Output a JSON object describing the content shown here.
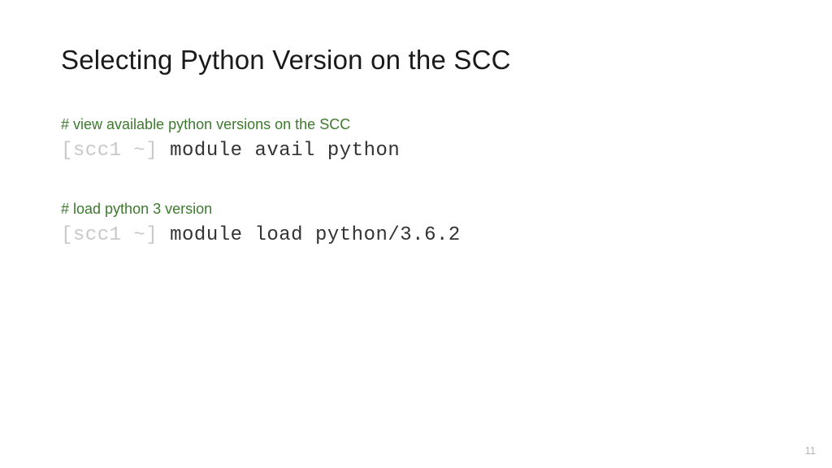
{
  "title": "Selecting Python Version on the SCC",
  "blocks": [
    {
      "comment": "# view available python versions on the SCC",
      "prompt": "[scc1 ~] ",
      "command": "module avail python"
    },
    {
      "comment": "# load python 3 version",
      "prompt": "[scc1 ~] ",
      "command": "module load python/3.6.2"
    }
  ],
  "page_number": "11"
}
